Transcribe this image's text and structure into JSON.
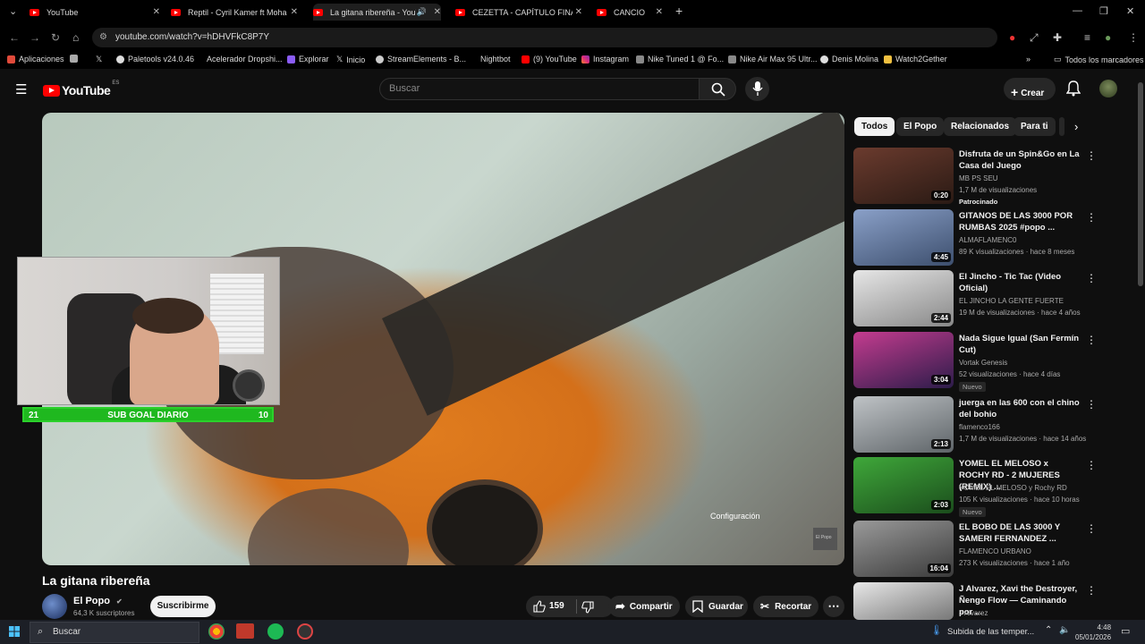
{
  "browser": {
    "tabs": [
      {
        "label": "YouTube"
      },
      {
        "label": "Reptil - Cyril Kamer ft Moha the"
      },
      {
        "label": "La gitana ribereña - YouTub"
      },
      {
        "label": "CEZETTA - CAPÍTULO FINAL (O"
      },
      {
        "label": "CANCIO"
      }
    ],
    "url": "youtube.com/watch?v=hDHVFkC8P7Y",
    "bookmarks": [
      "Aplicaciones",
      "Paletools v24.0.46",
      "Acelerador Dropshi...",
      "Explorar",
      "Inicio",
      "StreamElements - B...",
      "Nightbot",
      "(9) YouTube",
      "Instagram",
      "Nike Tuned 1 @ Fo...",
      "Nike Air Max 95 Ultr...",
      "Denis Molina",
      "Watch2Gether"
    ],
    "all_bookmarks": "Todos los marcadores"
  },
  "youtube": {
    "logo": "YouTube",
    "region": "ES",
    "search_placeholder": "Buscar",
    "create_label": "Crear"
  },
  "player": {
    "settings_tooltip": "Configuración",
    "watermark": "El Popo",
    "overlay": {
      "goal_label": "SUB GOAL DIARIO",
      "goal_current": "21",
      "goal_target": "10",
      "goal_progress": 1.0
    }
  },
  "video": {
    "title": "La gitana ribereña",
    "channel": "El Popo",
    "subscribers": "64,3 K suscriptores",
    "subscribe_label": "Suscribirme",
    "likes": "159",
    "share_label": "Compartir",
    "save_label": "Guardar",
    "clip_label": "Recortar"
  },
  "sidebar": {
    "chips": [
      "Todos",
      "El Popo",
      "Relacionados",
      "Para ti"
    ],
    "recommendations": [
      {
        "title": "Disfruta de un Spin&Go en La Casa del Juego",
        "channel": "MB PS SEU",
        "meta": "1,7 M de visualizaciones",
        "extra": "Patrocinado",
        "duration": "0:20",
        "color1": "#6b3b2e",
        "color2": "#2a1a14"
      },
      {
        "title": "GITANOS DE LAS 3000 POR RUMBAS 2025 #popo ...",
        "channel": "ALMAFLAMENC0",
        "meta": "89 K visualizaciones · hace 8 meses",
        "extra": "",
        "duration": "4:45",
        "color1": "#8aa0c8",
        "color2": "#3d4f6e"
      },
      {
        "title": "El Jincho - Tic Tac (Video Oficial)",
        "channel": "EL JINCHO LA GENTE FUERTE",
        "meta": "19 M de visualizaciones · hace 4 años",
        "extra": "",
        "duration": "2:44",
        "color1": "#e6e6e6",
        "color2": "#888888"
      },
      {
        "title": "Nada Sigue Igual (San Fermín Cut)",
        "channel": "Vortak Genesis",
        "meta": "52 visualizaciones · hace 4 días",
        "extra": "Nuevo",
        "duration": "3:04",
        "color1": "#c43c8f",
        "color2": "#2c1c4a"
      },
      {
        "title": "juerga en las 600 con el chino del bohio",
        "channel": "flamenco166",
        "meta": "1,7 M de visualizaciones · hace 14 años",
        "extra": "",
        "duration": "2:13",
        "color1": "#bfc3c6",
        "color2": "#5e6468"
      },
      {
        "title": "YOMEL EL MELOSO x ROCHY RD - 2 MUJERES (REMIX) ...",
        "channel": "YOMEL EL MELOSO y Rochy RD",
        "meta": "105 K visualizaciones · hace 10 horas",
        "extra": "Nuevo",
        "duration": "2:03",
        "color1": "#3fa83a",
        "color2": "#1b4d1c"
      },
      {
        "title": "EL BOBO DE LAS 3000 Y SAMERI FERNANDEZ ...",
        "channel": "FLAMENCO URBANO",
        "meta": "273 K visualizaciones · hace 1 año",
        "extra": "",
        "duration": "16:04",
        "color1": "#9a9a9a",
        "color2": "#3a3a3a"
      },
      {
        "title": "J Alvarez, Xavi the Destroyer, Ñengo Flow — Caminando por ...",
        "channel": "J Alvarez",
        "meta": "",
        "extra": "",
        "duration": "",
        "color1": "#e8e8e8",
        "color2": "#777777"
      }
    ]
  },
  "taskbar": {
    "search_placeholder": "Buscar",
    "weather": "Subida de las temper...",
    "time": "4:48",
    "date": "05/01/2026"
  }
}
